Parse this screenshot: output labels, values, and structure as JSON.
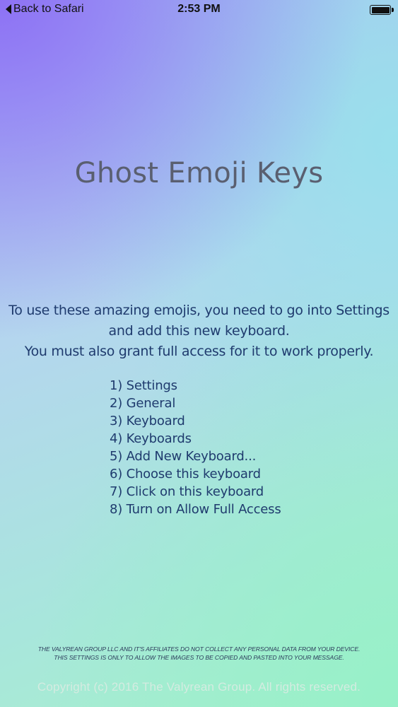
{
  "status_bar": {
    "back_label": "Back to Safari",
    "time": "2:53 PM",
    "battery_level": 1.0
  },
  "title": "Ghost Emoji Keys",
  "intro": {
    "line1": "To use these amazing emojis, you need to go into Settings",
    "line2": "and add this new keyboard.",
    "line3": "You must also grant full access for it to work properly."
  },
  "steps": [
    "1) Settings",
    "2) General",
    "3) Keyboard",
    "4) Keyboards",
    "5) Add New Keyboard...",
    "6) Choose this keyboard",
    "7) Click on this keyboard",
    "8) Turn on Allow Full Access"
  ],
  "disclaimer": {
    "line1": "THE VALYREAN GROUP LLC AND IT'S AFFILIATES DO NOT COLLECT ANY PERSONAL DATA FROM YOUR DEVICE.",
    "line2": "THIS SETTINGS IS ONLY TO ALLOW THE IMAGES TO BE COPIED AND PASTED INTO YOUR MESSAGE."
  },
  "copyright": "Copyright (c) 2016 The Valyrean Group. All rights reserved.",
  "colors": {
    "title": "#5a5f70",
    "body_text": "#1f3b6e",
    "copyright": "#d7ebe1"
  }
}
